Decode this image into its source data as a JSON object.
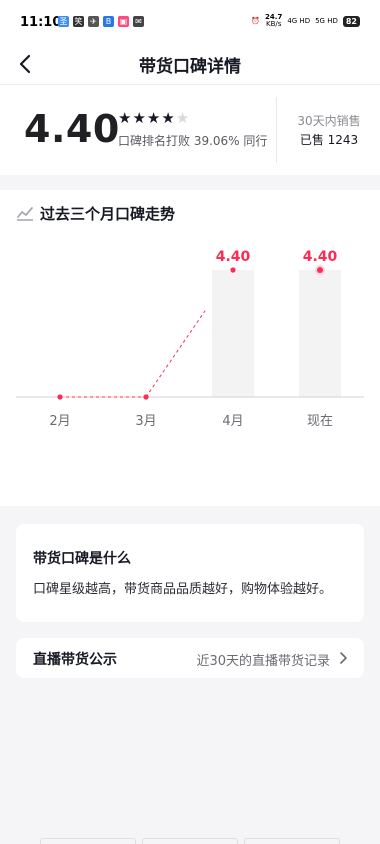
{
  "status_bar": {
    "time": "11:10",
    "apps": [
      {
        "icon": "app-icon-1",
        "glyph": "圣",
        "color": "#3b8cf2"
      },
      {
        "icon": "app-icon-2",
        "glyph": "笑",
        "color": "#333333"
      },
      {
        "icon": "app-icon-3",
        "glyph": "✈",
        "color": "#555555"
      },
      {
        "icon": "app-icon-4",
        "glyph": "B",
        "color": "#2a77e6"
      },
      {
        "icon": "app-icon-5",
        "glyph": "▣",
        "color": "#ff4a7a"
      },
      {
        "icon": "mail-icon",
        "glyph": "✉",
        "color": "#444444"
      }
    ],
    "net_speed": "24.7",
    "net_unit": "KB/s",
    "signal_1": "4G HD",
    "signal_2": "5G HD",
    "battery": "82"
  },
  "header": {
    "title": "带货口碑详情"
  },
  "score": {
    "value": "4.40",
    "stars_filled": 4,
    "stars_total": 5,
    "rank_text": "口碑排名打败 39.06% 同行",
    "sales_label": "30天内销售",
    "sales_value": "已售 1243"
  },
  "trend": {
    "title": "过去三个月口碑走势",
    "icon": "trend-chart-icon"
  },
  "chart_data": {
    "type": "bar",
    "categories": [
      "2月",
      "3月",
      "4月",
      "现在"
    ],
    "values": [
      0,
      0,
      4.4,
      4.4
    ],
    "labels": [
      "",
      "",
      "4.40",
      "4.40"
    ],
    "ylim": [
      0,
      4.4
    ],
    "line_color": "#fe2c55",
    "bar_color": "#f3f3f4"
  },
  "info": {
    "title": "带货口碑是什么",
    "desc": "口碑星级越高，带货商品品质越好，购物体验越好。"
  },
  "live": {
    "title": "直播带货公示",
    "link": "近30天的直播带货记录"
  },
  "colors": {
    "accent": "#fe2c55",
    "text": "#161823",
    "muted": "#8a8b91",
    "background": "#f5f5f7"
  }
}
